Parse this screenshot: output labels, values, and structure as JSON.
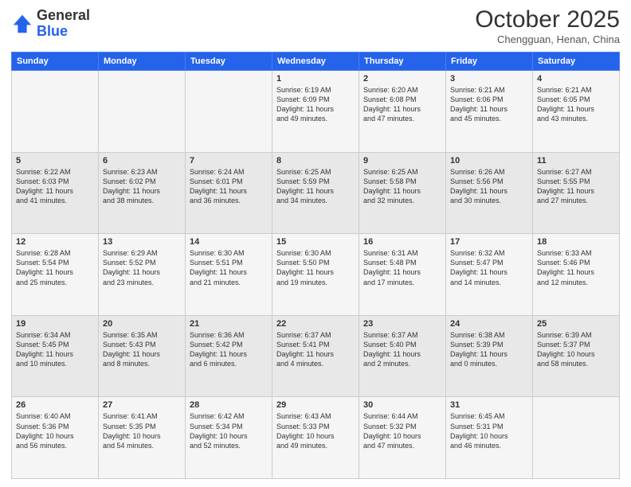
{
  "header": {
    "logo": {
      "line1": "General",
      "line2": "Blue"
    },
    "month": "October 2025",
    "location": "Chengguan, Henan, China"
  },
  "weekdays": [
    "Sunday",
    "Monday",
    "Tuesday",
    "Wednesday",
    "Thursday",
    "Friday",
    "Saturday"
  ],
  "weeks": [
    [
      {
        "day": "",
        "text": ""
      },
      {
        "day": "",
        "text": ""
      },
      {
        "day": "",
        "text": ""
      },
      {
        "day": "1",
        "text": "Sunrise: 6:19 AM\nSunset: 6:09 PM\nDaylight: 11 hours\nand 49 minutes."
      },
      {
        "day": "2",
        "text": "Sunrise: 6:20 AM\nSunset: 6:08 PM\nDaylight: 11 hours\nand 47 minutes."
      },
      {
        "day": "3",
        "text": "Sunrise: 6:21 AM\nSunset: 6:06 PM\nDaylight: 11 hours\nand 45 minutes."
      },
      {
        "day": "4",
        "text": "Sunrise: 6:21 AM\nSunset: 6:05 PM\nDaylight: 11 hours\nand 43 minutes."
      }
    ],
    [
      {
        "day": "5",
        "text": "Sunrise: 6:22 AM\nSunset: 6:03 PM\nDaylight: 11 hours\nand 41 minutes."
      },
      {
        "day": "6",
        "text": "Sunrise: 6:23 AM\nSunset: 6:02 PM\nDaylight: 11 hours\nand 38 minutes."
      },
      {
        "day": "7",
        "text": "Sunrise: 6:24 AM\nSunset: 6:01 PM\nDaylight: 11 hours\nand 36 minutes."
      },
      {
        "day": "8",
        "text": "Sunrise: 6:25 AM\nSunset: 5:59 PM\nDaylight: 11 hours\nand 34 minutes."
      },
      {
        "day": "9",
        "text": "Sunrise: 6:25 AM\nSunset: 5:58 PM\nDaylight: 11 hours\nand 32 minutes."
      },
      {
        "day": "10",
        "text": "Sunrise: 6:26 AM\nSunset: 5:56 PM\nDaylight: 11 hours\nand 30 minutes."
      },
      {
        "day": "11",
        "text": "Sunrise: 6:27 AM\nSunset: 5:55 PM\nDaylight: 11 hours\nand 27 minutes."
      }
    ],
    [
      {
        "day": "12",
        "text": "Sunrise: 6:28 AM\nSunset: 5:54 PM\nDaylight: 11 hours\nand 25 minutes."
      },
      {
        "day": "13",
        "text": "Sunrise: 6:29 AM\nSunset: 5:52 PM\nDaylight: 11 hours\nand 23 minutes."
      },
      {
        "day": "14",
        "text": "Sunrise: 6:30 AM\nSunset: 5:51 PM\nDaylight: 11 hours\nand 21 minutes."
      },
      {
        "day": "15",
        "text": "Sunrise: 6:30 AM\nSunset: 5:50 PM\nDaylight: 11 hours\nand 19 minutes."
      },
      {
        "day": "16",
        "text": "Sunrise: 6:31 AM\nSunset: 5:48 PM\nDaylight: 11 hours\nand 17 minutes."
      },
      {
        "day": "17",
        "text": "Sunrise: 6:32 AM\nSunset: 5:47 PM\nDaylight: 11 hours\nand 14 minutes."
      },
      {
        "day": "18",
        "text": "Sunrise: 6:33 AM\nSunset: 5:46 PM\nDaylight: 11 hours\nand 12 minutes."
      }
    ],
    [
      {
        "day": "19",
        "text": "Sunrise: 6:34 AM\nSunset: 5:45 PM\nDaylight: 11 hours\nand 10 minutes."
      },
      {
        "day": "20",
        "text": "Sunrise: 6:35 AM\nSunset: 5:43 PM\nDaylight: 11 hours\nand 8 minutes."
      },
      {
        "day": "21",
        "text": "Sunrise: 6:36 AM\nSunset: 5:42 PM\nDaylight: 11 hours\nand 6 minutes."
      },
      {
        "day": "22",
        "text": "Sunrise: 6:37 AM\nSunset: 5:41 PM\nDaylight: 11 hours\nand 4 minutes."
      },
      {
        "day": "23",
        "text": "Sunrise: 6:37 AM\nSunset: 5:40 PM\nDaylight: 11 hours\nand 2 minutes."
      },
      {
        "day": "24",
        "text": "Sunrise: 6:38 AM\nSunset: 5:39 PM\nDaylight: 11 hours\nand 0 minutes."
      },
      {
        "day": "25",
        "text": "Sunrise: 6:39 AM\nSunset: 5:37 PM\nDaylight: 10 hours\nand 58 minutes."
      }
    ],
    [
      {
        "day": "26",
        "text": "Sunrise: 6:40 AM\nSunset: 5:36 PM\nDaylight: 10 hours\nand 56 minutes."
      },
      {
        "day": "27",
        "text": "Sunrise: 6:41 AM\nSunset: 5:35 PM\nDaylight: 10 hours\nand 54 minutes."
      },
      {
        "day": "28",
        "text": "Sunrise: 6:42 AM\nSunset: 5:34 PM\nDaylight: 10 hours\nand 52 minutes."
      },
      {
        "day": "29",
        "text": "Sunrise: 6:43 AM\nSunset: 5:33 PM\nDaylight: 10 hours\nand 49 minutes."
      },
      {
        "day": "30",
        "text": "Sunrise: 6:44 AM\nSunset: 5:32 PM\nDaylight: 10 hours\nand 47 minutes."
      },
      {
        "day": "31",
        "text": "Sunrise: 6:45 AM\nSunset: 5:31 PM\nDaylight: 10 hours\nand 46 minutes."
      },
      {
        "day": "",
        "text": ""
      }
    ]
  ]
}
